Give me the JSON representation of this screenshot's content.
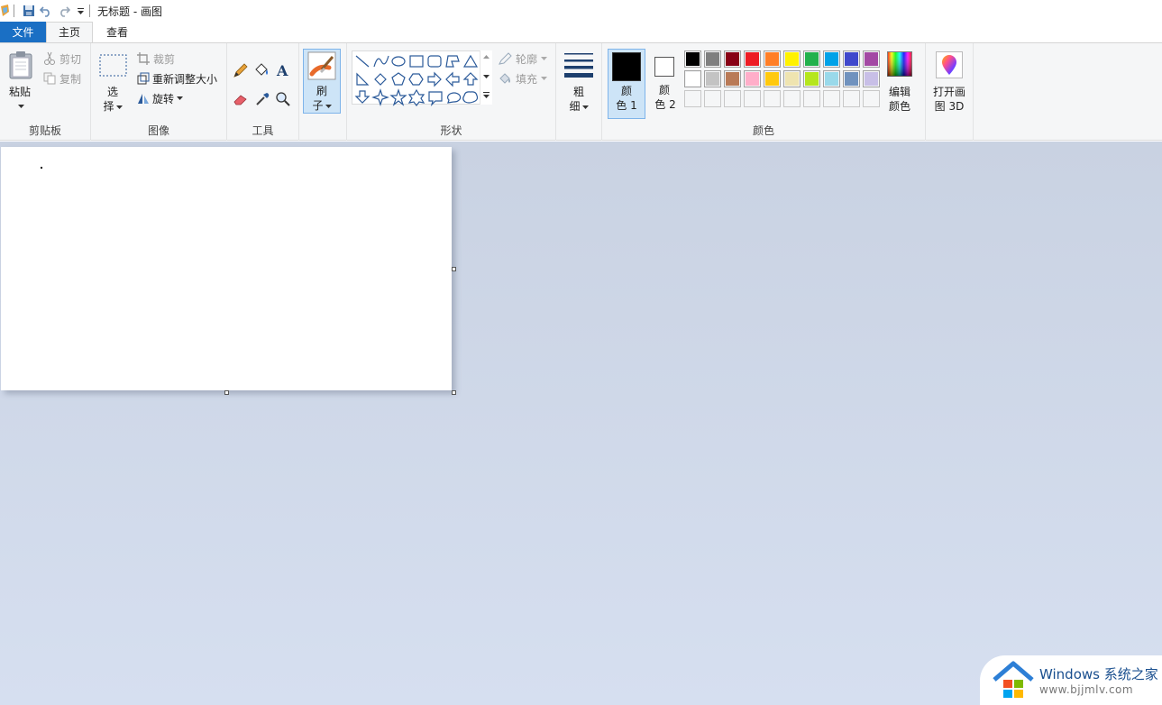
{
  "window": {
    "title": "无标题 - 画图"
  },
  "tabs": {
    "file": "文件",
    "home": "主页",
    "view": "查看"
  },
  "clipboard": {
    "paste": "粘贴",
    "cut": "剪切",
    "copy": "复制",
    "label": "剪贴板"
  },
  "image": {
    "select_1": "选",
    "select_2": "择",
    "crop": "裁剪",
    "resize": "重新调整大小",
    "rotate": "旋转",
    "label": "图像"
  },
  "tools": {
    "label": "工具"
  },
  "brushes": {
    "label_1": "刷",
    "label_2": "子"
  },
  "shapes": {
    "outline": "轮廓",
    "fill": "填充",
    "label": "形状"
  },
  "size": {
    "label_1": "粗",
    "label_2": "细"
  },
  "colors": {
    "color1_1": "颜",
    "color1_2": "色 1",
    "color2_1": "颜",
    "color2_2": "色 2",
    "edit_1": "编辑",
    "edit_2": "颜色",
    "label": "颜色",
    "color1_value": "#000000",
    "color2_value": "#ffffff",
    "palette_row1": [
      "#000000",
      "#7f7f7f",
      "#880015",
      "#ed1c24",
      "#ff7f27",
      "#fff200",
      "#22b14c",
      "#00a2e8",
      "#3f48cc",
      "#a349a4"
    ],
    "palette_row2": [
      "#ffffff",
      "#c3c3c3",
      "#b97a57",
      "#ffaec9",
      "#ffc90e",
      "#efe4b0",
      "#b5e61d",
      "#99d9ea",
      "#7092be",
      "#c8bfe7"
    ]
  },
  "paint3d": {
    "label_1": "打开画",
    "label_2": "图 3D"
  },
  "watermark": {
    "line1": "Windows 系统之家",
    "line2": "www.bjjmlv.com"
  }
}
